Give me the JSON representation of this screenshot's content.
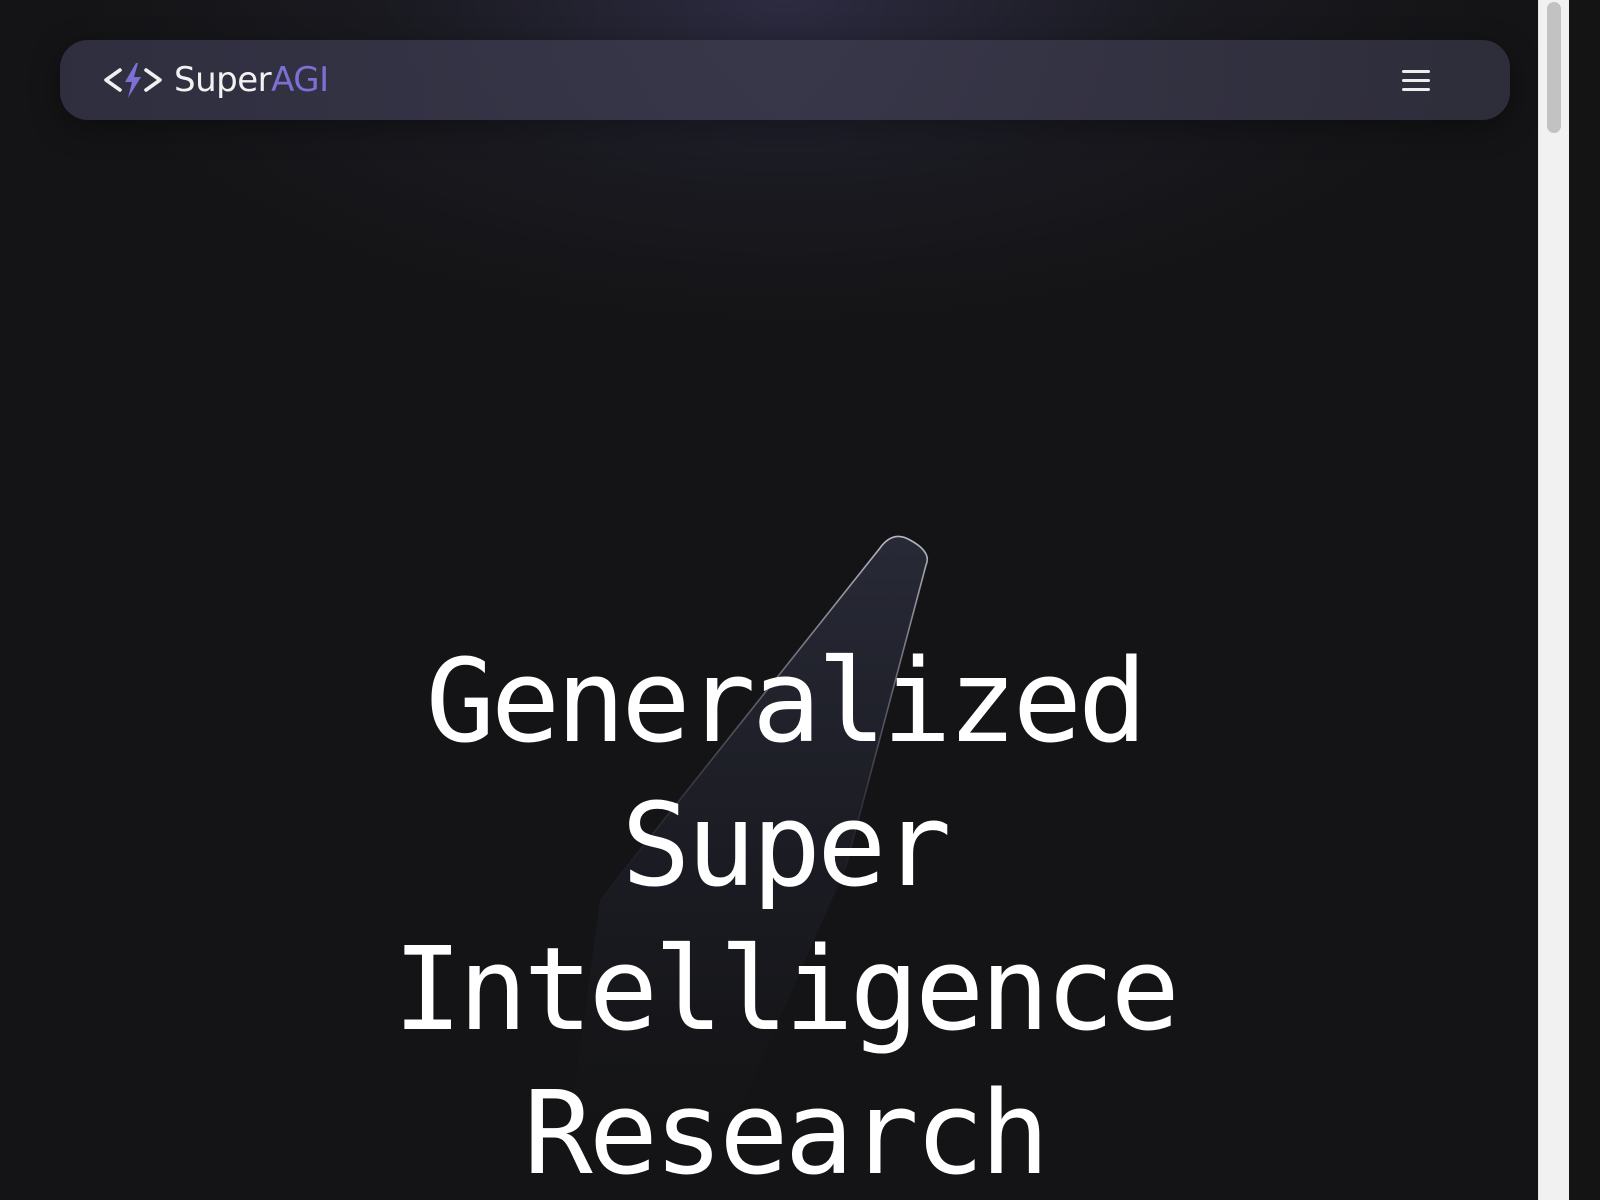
{
  "navbar": {
    "logo_icon": "code-bolt-icon",
    "brand_primary": "Super",
    "brand_accent": "AGI",
    "menu_icon": "hamburger-menu-icon"
  },
  "hero": {
    "title_lines": [
      "Generalized",
      "Super",
      "Intelligence",
      "Research"
    ]
  },
  "colors": {
    "background": "#141416",
    "accent": "#7b70d4",
    "text": "#ffffff"
  }
}
